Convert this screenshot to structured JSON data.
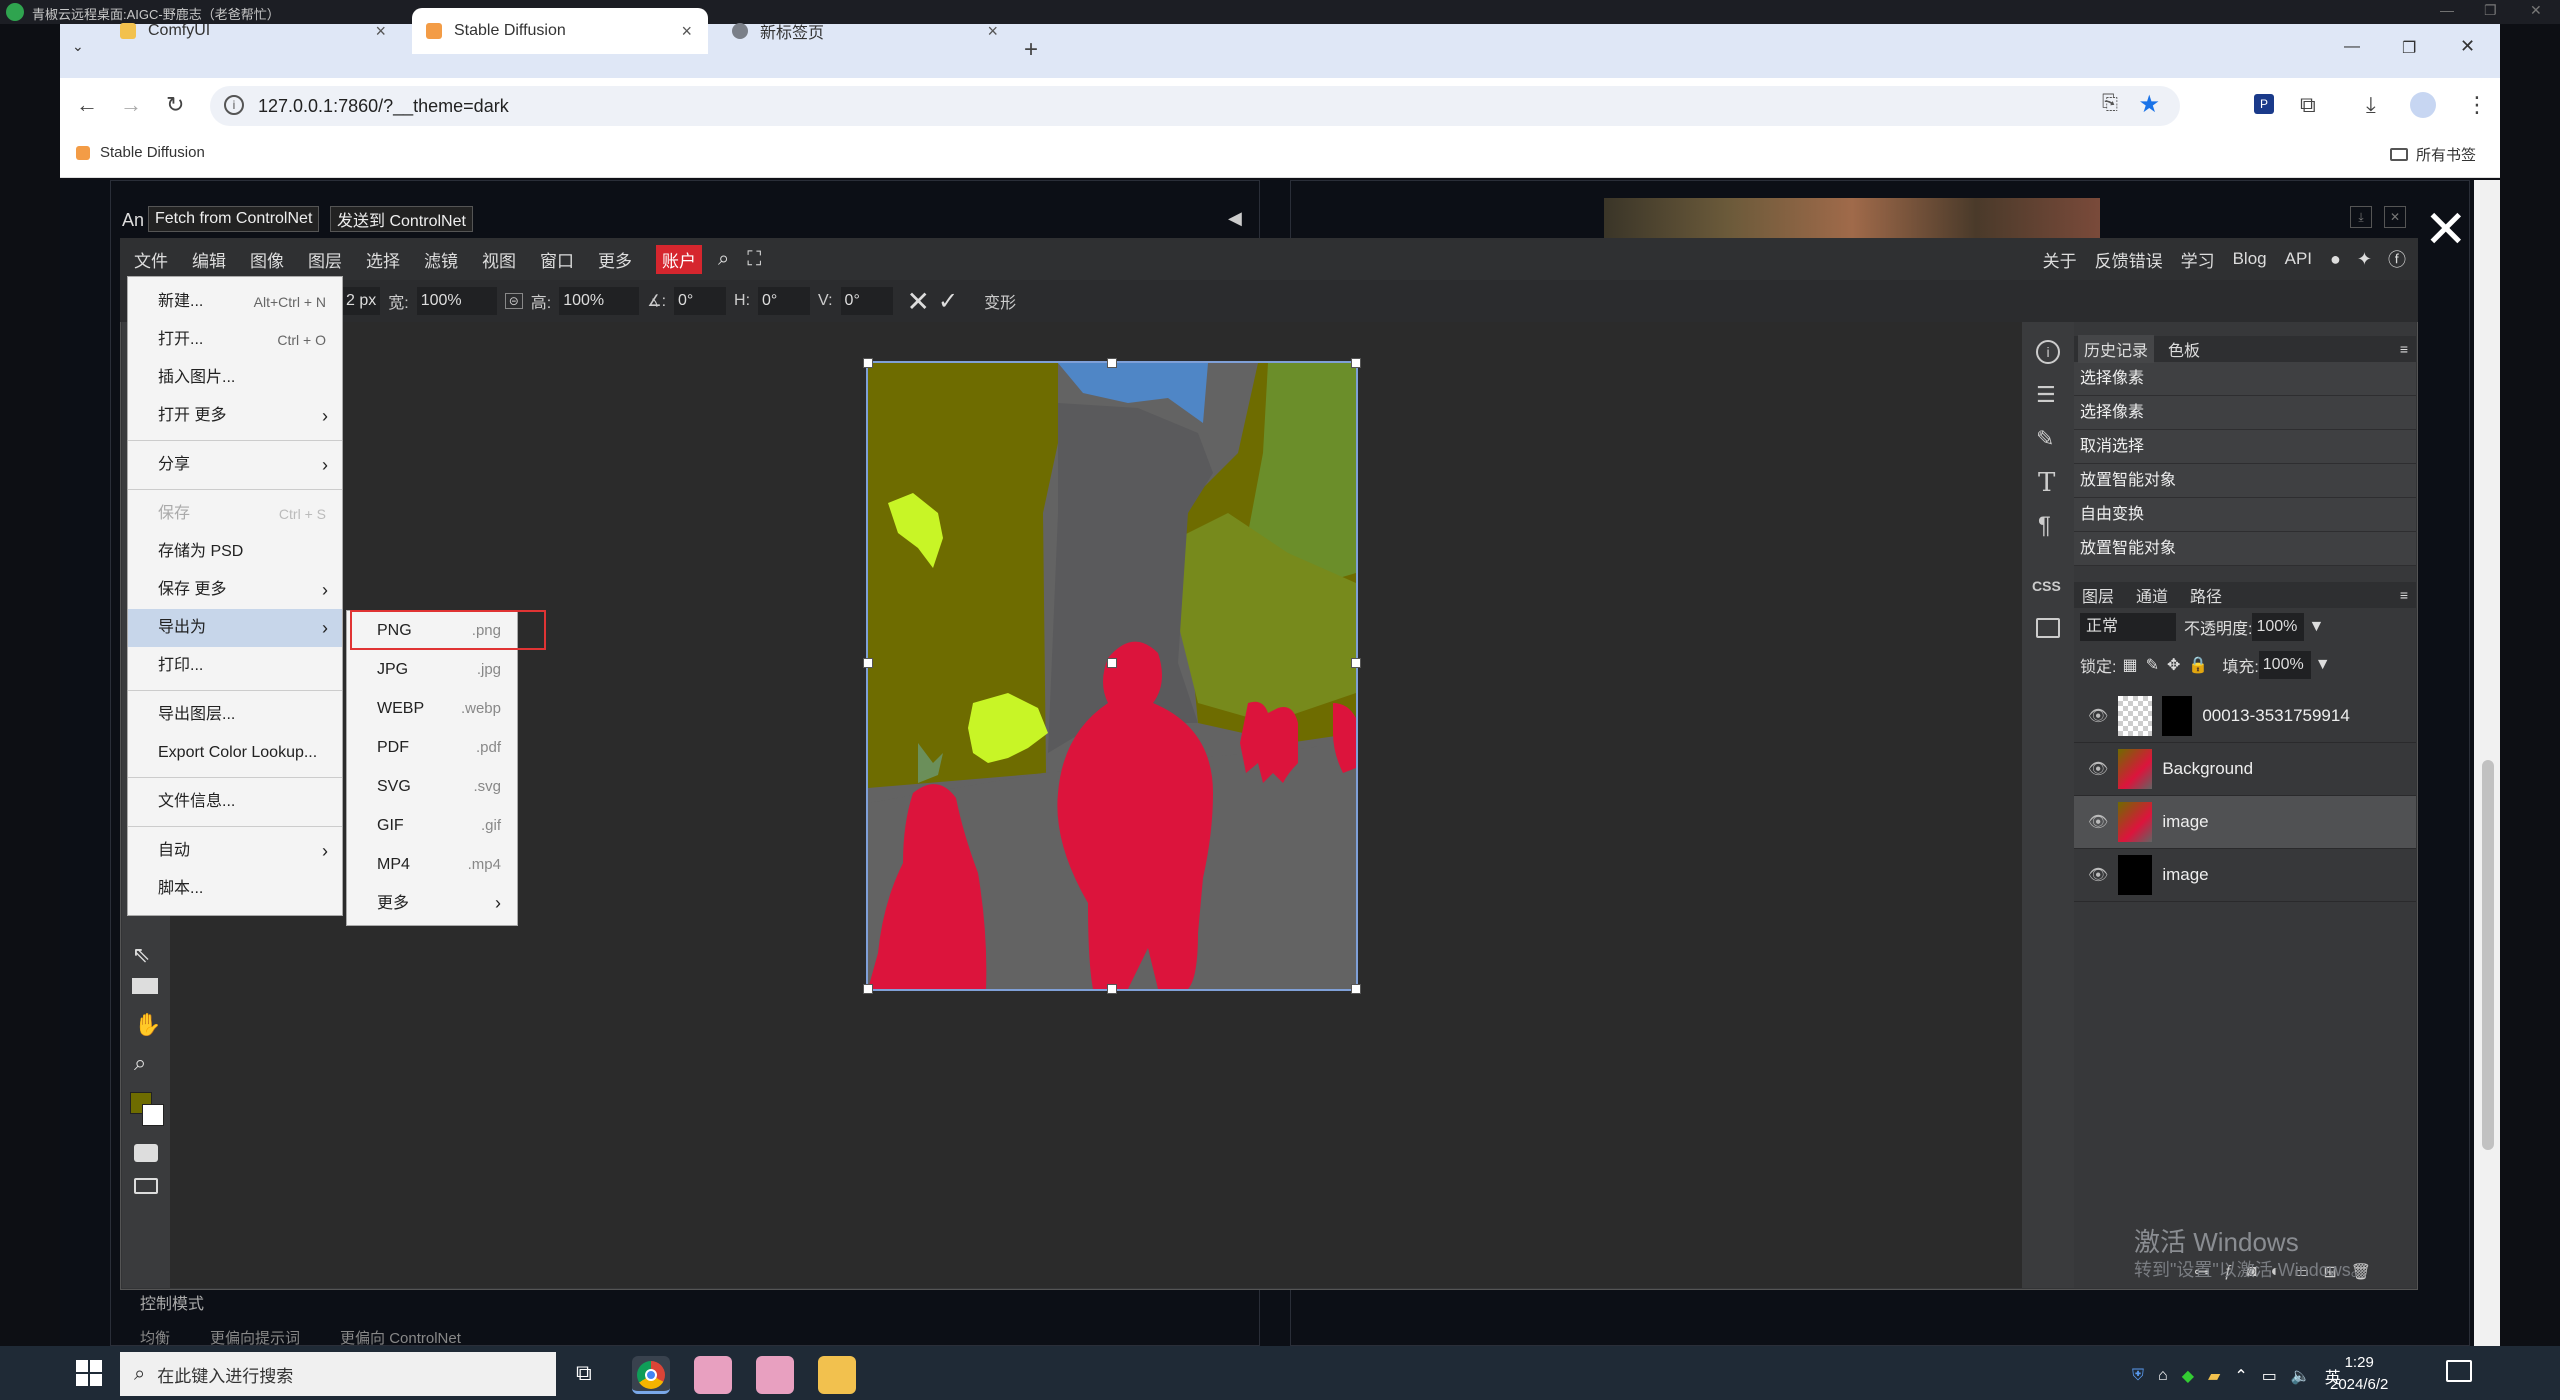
{
  "window": {
    "title": "青椒云远程桌面:AIGC-野鹿志（老爸帮忙）",
    "controls": [
      "—",
      "❐",
      "✕"
    ]
  },
  "browser": {
    "tabs": [
      {
        "label": "ComfyUI",
        "active": false
      },
      {
        "label": "Stable Diffusion",
        "active": true
      },
      {
        "label": "新标签页",
        "active": false
      }
    ],
    "new_tab": "+",
    "url": "127.0.0.1:7860/?__theme=dark",
    "bookmark": "Stable Diffusion",
    "all_bookmarks": "所有书签",
    "window_controls": [
      "—",
      "❐",
      "✕"
    ]
  },
  "webui": {
    "fetch_button": "Fetch from ControlNet",
    "send_button": "发送到 ControlNet",
    "hidden_label": "An",
    "collapse_arrow": "◀",
    "close": "✕",
    "control_mode_label": "控制模式",
    "control_options": [
      "均衡",
      "更偏向提示词",
      "更偏向 ControlNet"
    ]
  },
  "photopea": {
    "menu": [
      "文件",
      "编辑",
      "图像",
      "图层",
      "选择",
      "滤镜",
      "视图",
      "窗口",
      "更多"
    ],
    "account": "账户",
    "right_links": [
      "关于",
      "反馈错误",
      "学习",
      "Blog",
      "API"
    ],
    "options": {
      "px": "2 px",
      "w_label": "宽:",
      "w_value": "100%",
      "h_label": "高:",
      "h_value": "100%",
      "angle_label": "∡:",
      "angle_value": "0°",
      "hskew_label": "H:",
      "hskew_value": "0°",
      "vskew_label": "V:",
      "vskew_value": "0°",
      "transform_label": "变形"
    },
    "file_menu": [
      {
        "label": "新建...",
        "shortcut": "Alt+Ctrl + N"
      },
      {
        "label": "打开...",
        "shortcut": "Ctrl + O"
      },
      {
        "label": "插入图片...",
        "shortcut": ""
      },
      {
        "label": "打开 更多",
        "arrow": "›"
      },
      {
        "label": "分享",
        "arrow": "›"
      },
      {
        "label": "保存",
        "shortcut": "Ctrl + S"
      },
      {
        "label": "存储为 PSD"
      },
      {
        "label": "保存 更多",
        "arrow": "›"
      },
      {
        "label": "导出为",
        "arrow": "›"
      },
      {
        "label": "打印..."
      },
      {
        "label": "导出图层..."
      },
      {
        "label": "Export Color Lookup..."
      },
      {
        "label": "文件信息..."
      },
      {
        "label": "自动",
        "arrow": "›"
      },
      {
        "label": "脚本..."
      }
    ],
    "export_menu": [
      {
        "label": "PNG",
        "ext": ".png"
      },
      {
        "label": "JPG",
        "ext": ".jpg"
      },
      {
        "label": "WEBP",
        "ext": ".webp"
      },
      {
        "label": "PDF",
        "ext": ".pdf"
      },
      {
        "label": "SVG",
        "ext": ".svg"
      },
      {
        "label": "GIF",
        "ext": ".gif"
      },
      {
        "label": "MP4",
        "ext": ".mp4"
      },
      {
        "label": "更多",
        "arrow": "›"
      }
    ],
    "history_tabs": [
      "历史记录",
      "色板"
    ],
    "history": [
      "选择像素",
      "选择像素",
      "取消选择",
      "放置智能对象",
      "自由变换",
      "放置智能对象"
    ],
    "layer_tabs": [
      "图层",
      "通道",
      "路径"
    ],
    "blend_mode": "正常",
    "opacity_label": "不透明度:",
    "opacity_value": "100%",
    "lock_label": "锁定:",
    "fill_label": "填充:",
    "fill_value": "100%",
    "layers": [
      "00013-3531759914",
      "Background",
      "image",
      "image"
    ],
    "colors": {
      "foreground": "#6e6c00",
      "background": "#ffffff",
      "account": "#d6262e"
    }
  },
  "taskbar": {
    "search_placeholder": "在此键入进行搜索",
    "time": "1:29",
    "date": "2024/6/2",
    "lang": "英"
  },
  "watermark": {
    "line1": "激活 Windows",
    "line2": "转到\"设置\"以激活 Windows。"
  }
}
